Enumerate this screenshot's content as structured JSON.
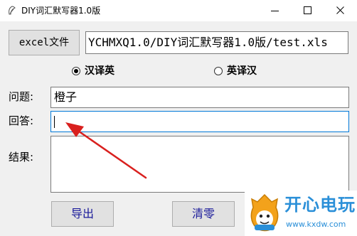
{
  "window": {
    "title": "DIY词汇默写器1.0版",
    "controls": [
      "minimize",
      "maximize",
      "close"
    ]
  },
  "file": {
    "button_label": "excel文件",
    "path_value": "YCHMXQ1.0/DIY词汇默写器1.0版/test.xls"
  },
  "mode": {
    "options": [
      {
        "label": "汉译英",
        "selected": true
      },
      {
        "label": "英译汉",
        "selected": false
      }
    ]
  },
  "form": {
    "question_label": "问题:",
    "question_value": "橙子",
    "answer_label": "回答:",
    "answer_value": "",
    "result_label": "结果:",
    "result_value": ""
  },
  "actions": {
    "export_label": "导出",
    "clear_label": "清零"
  },
  "annotation": {
    "arrow_color": "#d9201e"
  },
  "watermark": {
    "brand": "开心电玩",
    "url": "www.kxdw.com",
    "color": "#2a8fd8"
  }
}
